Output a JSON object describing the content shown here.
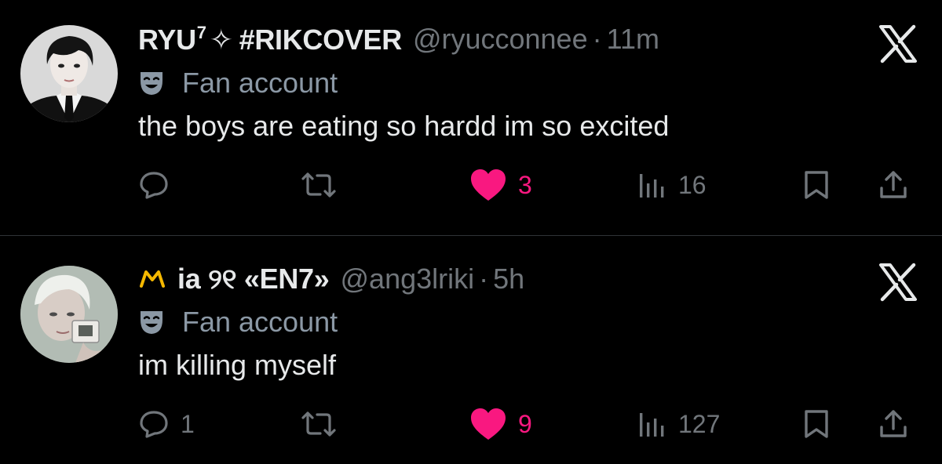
{
  "posts": [
    {
      "display_name": "RYU",
      "name_superscript": "7",
      "name_sparkle": "✧",
      "name_hashtag": "#RIKCOVER",
      "handle": "@ryucconnee",
      "separator": "·",
      "time": "11m",
      "label": "Fan account",
      "text": "the boys are eating so hardd im so excited",
      "reply_count": "",
      "like_count": "3",
      "view_count": "16",
      "liked": true
    },
    {
      "display_name": "ia ୨୧ «EN7»",
      "handle": "@ang3lriki",
      "separator": "·",
      "time": "5h",
      "label": "Fan account",
      "text": "im killing myself",
      "reply_count": "1",
      "like_count": "9",
      "view_count": "127",
      "liked": true
    }
  ],
  "colors": {
    "background": "#000000",
    "text_primary": "#e7e9ea",
    "text_secondary": "#71767b",
    "like_pink": "#f91880",
    "divider": "#2f3336",
    "crown_yellow": "#f5b800"
  },
  "icons": {
    "reply": "speech-bubble-icon",
    "repost": "repost-arrows-icon",
    "like": "heart-icon",
    "views": "bar-chart-icon",
    "bookmark": "bookmark-icon",
    "share": "share-upload-icon",
    "brand": "x-logo-icon",
    "badge": "theater-mask-icon",
    "crown": "crown-icon"
  }
}
